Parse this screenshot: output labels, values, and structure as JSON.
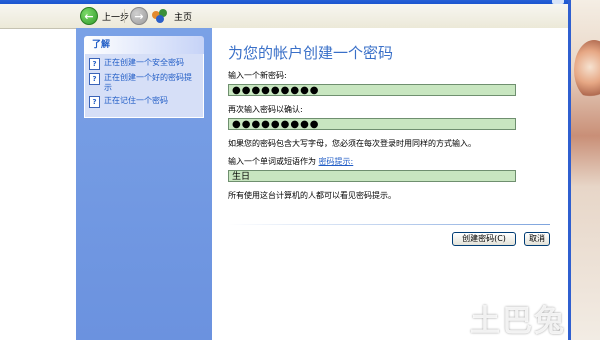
{
  "toolbar": {
    "back_label": "上一步",
    "home_label": "主页"
  },
  "sidebar": {
    "header": "了解",
    "items": [
      {
        "label": "正在创建一个安全密码"
      },
      {
        "label": "正在创建一个好的密码提示"
      },
      {
        "label": "正在记住一个密码"
      }
    ]
  },
  "main": {
    "heading": "为您的帐户创建一个密码",
    "new_password_label": "输入一个新密码:",
    "new_password_value": "●●●●●●●●●",
    "confirm_label": "再次输入密码以确认:",
    "confirm_value": "●●●●●●●●●",
    "caps_note": "如果您的密码包含大写字母，您必须在每次登录时用同样的方式输入。",
    "hint_label_prefix": "输入一个单词或短语作为",
    "hint_link": "密码提示:",
    "hint_value": "生日",
    "hint_visible_note": "所有使用这台计算机的人都可以看见密码提示。",
    "create_button": "创建密码(C)",
    "cancel_button": "取消"
  },
  "watermark": "土巴兔",
  "colors": {
    "link": "#215dc6",
    "heading": "#3a70c8",
    "field_bg": "#c8e6c0",
    "sidebar_bg": "#7aa1e6"
  }
}
